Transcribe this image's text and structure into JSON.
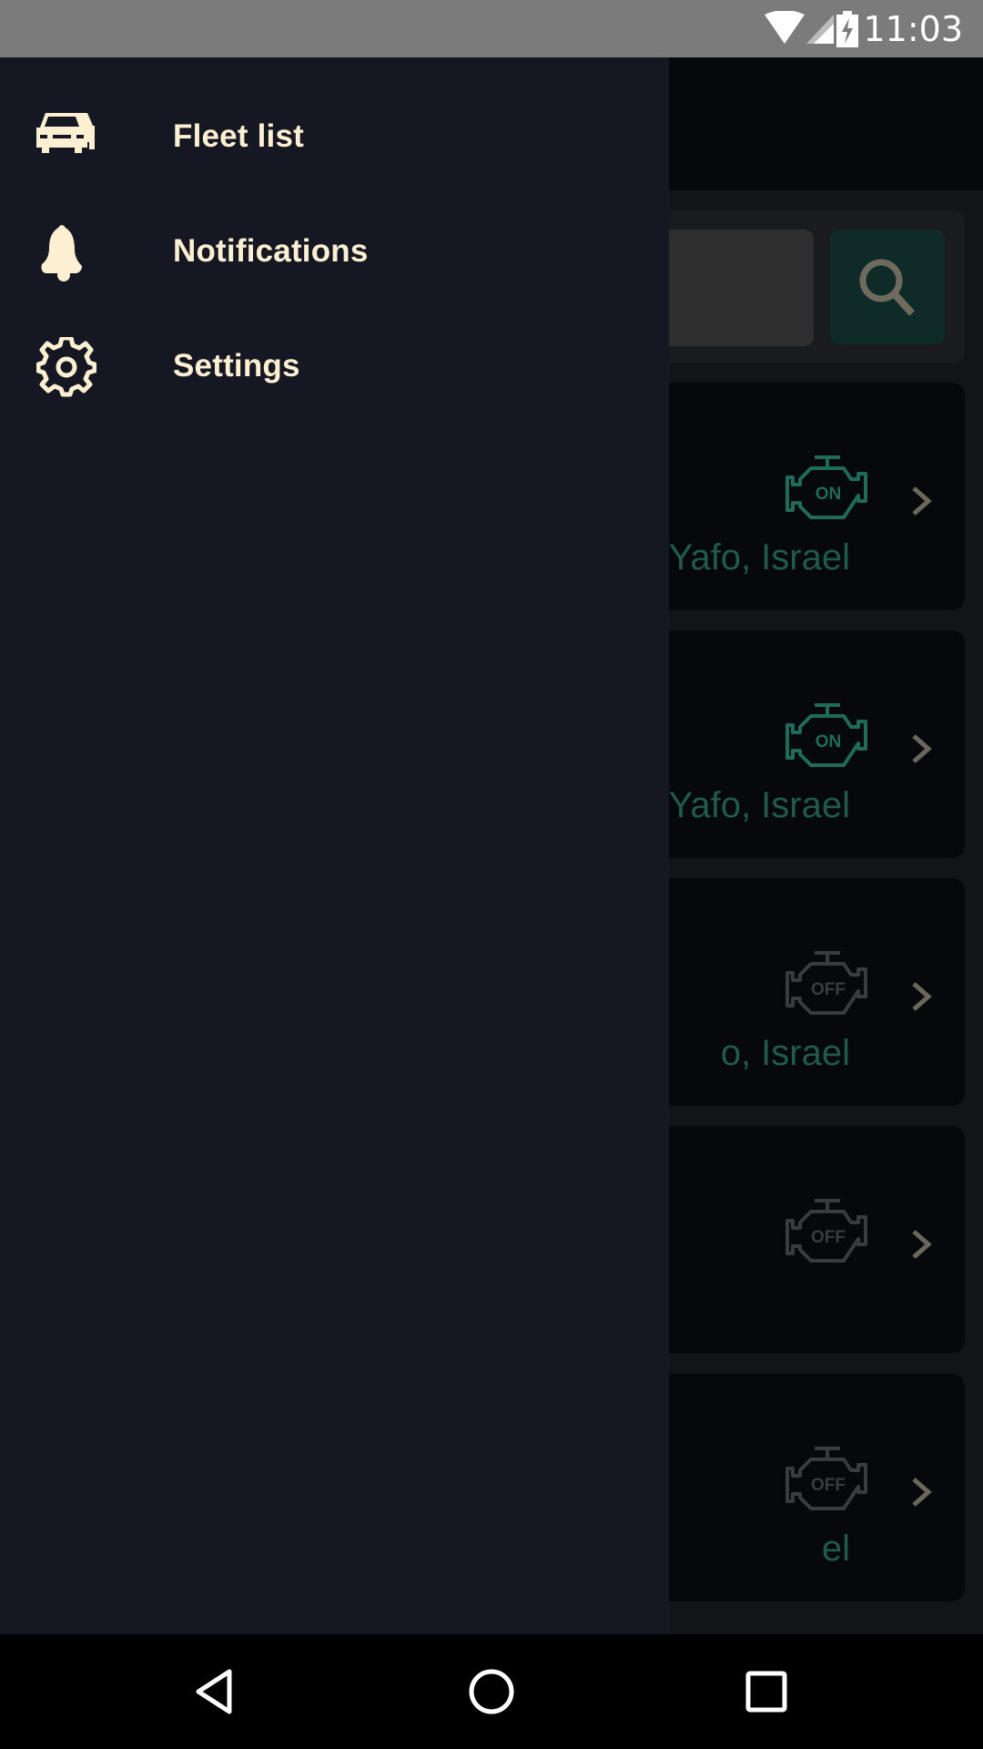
{
  "status_bar": {
    "time": "11:03",
    "icons": [
      "wifi-icon",
      "signal-icon",
      "battery-charging-icon"
    ]
  },
  "search": {
    "placeholder": "",
    "button_icon": "search-icon"
  },
  "cards": [
    {
      "location": "Yafo, Israel",
      "engine_status": "ON",
      "engine_color": "#1f6b5a"
    },
    {
      "location": "Yafo, Israel",
      "engine_status": "ON",
      "engine_color": "#1f6b5a"
    },
    {
      "location": "o, Israel",
      "engine_status": "OFF",
      "engine_color": "#3a3b3e"
    },
    {
      "location": "",
      "engine_status": "OFF",
      "engine_color": "#3a3b3e"
    },
    {
      "location": "el",
      "engine_status": "OFF",
      "engine_color": "#3a3b3e"
    }
  ],
  "drawer": {
    "items": [
      {
        "label": "Fleet list",
        "icon": "cars-icon"
      },
      {
        "label": "Notifications",
        "icon": "bell-icon"
      },
      {
        "label": "Settings",
        "icon": "gear-icon"
      }
    ]
  },
  "colors": {
    "drawer_bg": "#151823",
    "drawer_text": "#fdf0d2",
    "accent": "#1f6b5a"
  },
  "nav_bar": {
    "buttons": [
      "back-icon",
      "home-icon",
      "recents-icon"
    ]
  }
}
